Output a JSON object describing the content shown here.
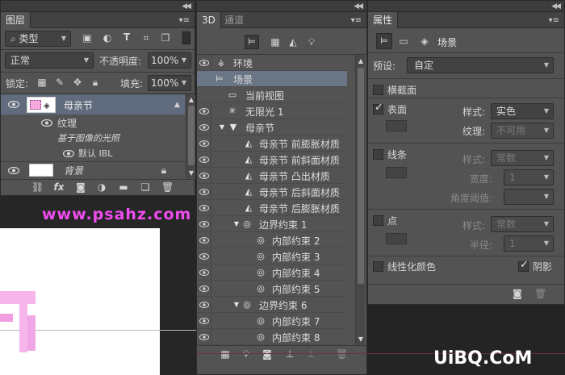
{
  "layers_panel": {
    "tabs": [
      "图层"
    ],
    "filter": {
      "kind": "类型"
    },
    "blend_mode": "正常",
    "opacity_label": "不透明度:",
    "opacity_value": "100%",
    "lock_label": "锁定:",
    "fill_label": "填充:",
    "fill_value": "100%",
    "layers": {
      "main_layer": "母亲节",
      "texture": "纹理",
      "image_based_light": "基于图像的光照",
      "default_ibl": "默认 IBL",
      "background": "背景"
    }
  },
  "watermark_top": "www.psahz.com",
  "panel_3d": {
    "tabs": [
      "3D",
      "通道"
    ],
    "items": [
      {
        "label": "环境"
      },
      {
        "label": "场景"
      },
      {
        "label": "当前视图"
      },
      {
        "label": "无限光 1"
      },
      {
        "label": "母亲节"
      },
      {
        "label": "母亲节 前膨胀材质"
      },
      {
        "label": "母亲节 前斜面材质"
      },
      {
        "label": "母亲节 凸出材质"
      },
      {
        "label": "母亲节 后斜面材质"
      },
      {
        "label": "母亲节 后膨胀材质"
      },
      {
        "label": "边界约束 1"
      },
      {
        "label": "内部约束 2"
      },
      {
        "label": "内部约束 3"
      },
      {
        "label": "内部约束 4"
      },
      {
        "label": "内部约束 5"
      },
      {
        "label": "边界约束 6"
      },
      {
        "label": "内部约束 7"
      },
      {
        "label": "内部约束 8"
      }
    ]
  },
  "properties_panel": {
    "tabs": [
      "属性"
    ],
    "header": "场景",
    "preset_label": "预设:",
    "preset_value": "自定",
    "cross_section": "横截面",
    "surface": "表面",
    "surface_style_label": "样式:",
    "surface_style_value": "实色",
    "texture_label": "纹理:",
    "texture_value": "不可用",
    "lines": "线条",
    "lines_style_label": "样式:",
    "lines_style_value": "常数",
    "width_label": "宽度:",
    "width_value": "1",
    "angle_label": "角度阈值:",
    "points": "点",
    "points_style_label": "样式:",
    "points_style_value": "常数",
    "radius_label": "半径:",
    "radius_value": "1",
    "linearize_colors": "线性化颜色",
    "shadows": "阴影"
  },
  "watermark_bottom": "UiBQ.CoM"
}
